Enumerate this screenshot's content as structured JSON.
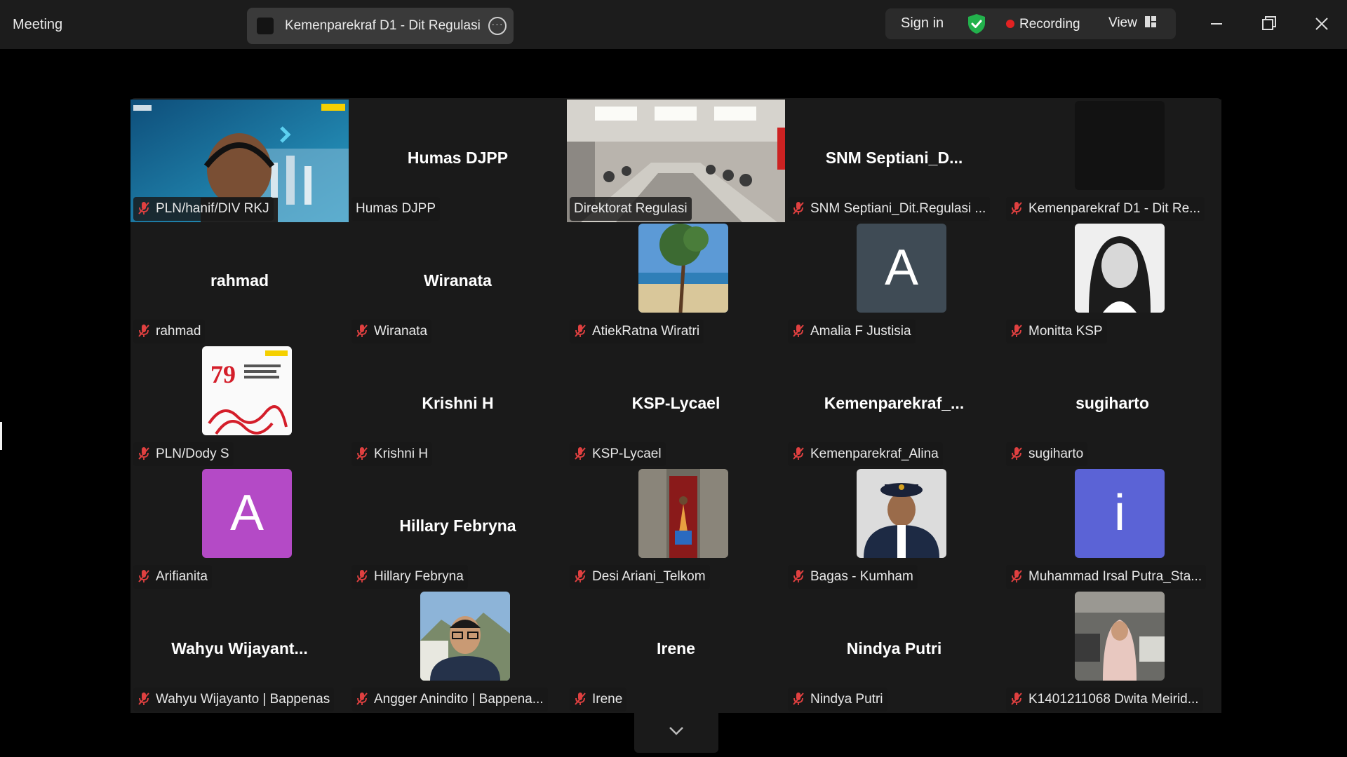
{
  "app": {
    "title": "Meeting"
  },
  "meeting": {
    "name": "Kemenparekraf D1 - Dit Regulasi"
  },
  "toolbar": {
    "sign_in": "Sign in",
    "recording": "Recording",
    "view": "View"
  },
  "colors": {
    "active_speaker": "#23d160",
    "recording_dot": "#e22222",
    "muted_mic": "#e04040"
  },
  "tiles": [
    {
      "id": "t00",
      "label": "PLN/hanif/DIV RKJ",
      "kind": "video"
    },
    {
      "id": "t01",
      "label": "Humas DJPP",
      "display": "Humas DJPP",
      "kind": "name",
      "muted": false
    },
    {
      "id": "t02",
      "label": "Direktorat Regulasi",
      "kind": "video",
      "active": true,
      "muted": false
    },
    {
      "id": "t03",
      "label": "SNM Septiani_Dit.Regulasi ...",
      "display": "SNM  Septiani_D...",
      "kind": "name"
    },
    {
      "id": "t04",
      "label": "Kemenparekraf D1 - Dit Re...",
      "kind": "blank"
    },
    {
      "id": "t10",
      "label": "rahmad",
      "display": "rahmad",
      "kind": "name"
    },
    {
      "id": "t11",
      "label": "Wiranata",
      "display": "Wiranata",
      "kind": "name"
    },
    {
      "id": "t12",
      "label": "AtiekRatna Wiratri",
      "kind": "photo-beach"
    },
    {
      "id": "t13",
      "label": "Amalia F Justisia",
      "letter": "A",
      "letter_bg": "#3f4b55",
      "kind": "letter"
    },
    {
      "id": "t14",
      "label": "Monitta KSP",
      "kind": "photo-portrait"
    },
    {
      "id": "t20",
      "label": "PLN/Dody S",
      "kind": "photo-poster"
    },
    {
      "id": "t21",
      "label": "Krishni H",
      "display": "Krishni H",
      "kind": "name"
    },
    {
      "id": "t22",
      "label": "KSP-Lycael",
      "display": "KSP-Lycael",
      "kind": "name"
    },
    {
      "id": "t23",
      "label": "Kemenparekraf_Alina",
      "display": "Kemenparekraf_...",
      "kind": "name"
    },
    {
      "id": "t24",
      "label": "sugiharto",
      "display": "sugiharto",
      "kind": "name"
    },
    {
      "id": "t30",
      "label": "Arifianita",
      "letter": "A",
      "letter_bg": "#b44ac6",
      "kind": "letter"
    },
    {
      "id": "t31",
      "label": "Hillary Febryna",
      "display": "Hillary Febryna",
      "kind": "name"
    },
    {
      "id": "t32",
      "label": "Desi Ariani_Telkom",
      "kind": "photo-temple"
    },
    {
      "id": "t33",
      "label": "Bagas - Kumham",
      "kind": "photo-uniform"
    },
    {
      "id": "t34",
      "label": "Muhammad Irsal Putra_Sta...",
      "letter": "i",
      "letter_bg": "#5b63d6",
      "kind": "letter"
    },
    {
      "id": "t40",
      "label": "Wahyu Wijayanto | Bappenas",
      "display": "Wahyu  Wijayant...",
      "kind": "name"
    },
    {
      "id": "t41",
      "label": "Angger Anindito | Bappena...",
      "kind": "photo-man"
    },
    {
      "id": "t42",
      "label": "Irene",
      "display": "Irene",
      "kind": "name"
    },
    {
      "id": "t43",
      "label": "Nindya Putri",
      "display": "Nindya Putri",
      "kind": "name"
    },
    {
      "id": "t44",
      "label": "K1401211068 Dwita Meirid...",
      "kind": "photo-hijab"
    }
  ]
}
